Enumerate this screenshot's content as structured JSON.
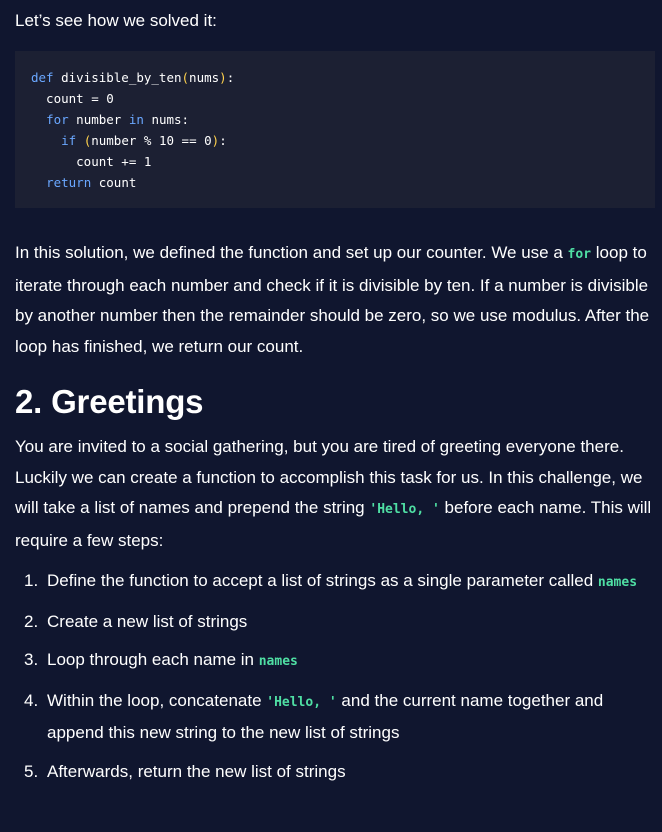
{
  "intro": "Let’s see how we solved it:",
  "code": {
    "def_kw": "def",
    "func_name": " divisible_by_ten",
    "open_paren": "(",
    "param": "nums",
    "close_paren": ")",
    "colon": ":",
    "line2": "  count = 0",
    "for_kw": "for",
    "for_mid": " number ",
    "in_kw": "in",
    "for_end": " nums:",
    "if_kw": "if",
    "if_cond": "number % 10 == 0",
    "if_colon": ":",
    "line5": "      count += 1",
    "return_kw": "return",
    "return_val": " count"
  },
  "solution_para": {
    "part1": "In this solution, we defined the function and set up our counter. We use a ",
    "code_for": "for",
    "part2": " loop to iterate through each number and check if it is divisible by ten. If a number is divisible by another number then the remainder should be zero, so we use modulus. After the loop has finished, we return our count."
  },
  "heading": "2. Greetings",
  "greetings_para": {
    "part1": "You are invited to a social gathering, but you are tired of greeting everyone there. Luckily we can create a function to accomplish this task for us. In this challenge, we will take a list of names and prepend the string ",
    "code_hello": "'Hello, '",
    "part2": " before each name. This will require a few steps:"
  },
  "steps": [
    {
      "num": "1.",
      "text": "Define the function to accept a list of strings as a single parameter called ",
      "code": "names",
      "after": ""
    },
    {
      "num": "2.",
      "text": "Create a new list of strings",
      "code": "",
      "after": ""
    },
    {
      "num": "3.",
      "text": "Loop through each name in ",
      "code": "names",
      "after": ""
    },
    {
      "num": "4.",
      "text": "Within the loop, concatenate ",
      "code": "'Hello, '",
      "after": " and the current name together and append this new string to the new list of strings"
    },
    {
      "num": "5.",
      "text": "Afterwards, return the new list of strings",
      "code": "",
      "after": ""
    }
  ],
  "colors": {
    "background": "#10162f",
    "code_background": "#1c2033",
    "keyword": "#6aa7ff",
    "paren": "#ffd24d",
    "inline_code": "#4fdfa4"
  }
}
